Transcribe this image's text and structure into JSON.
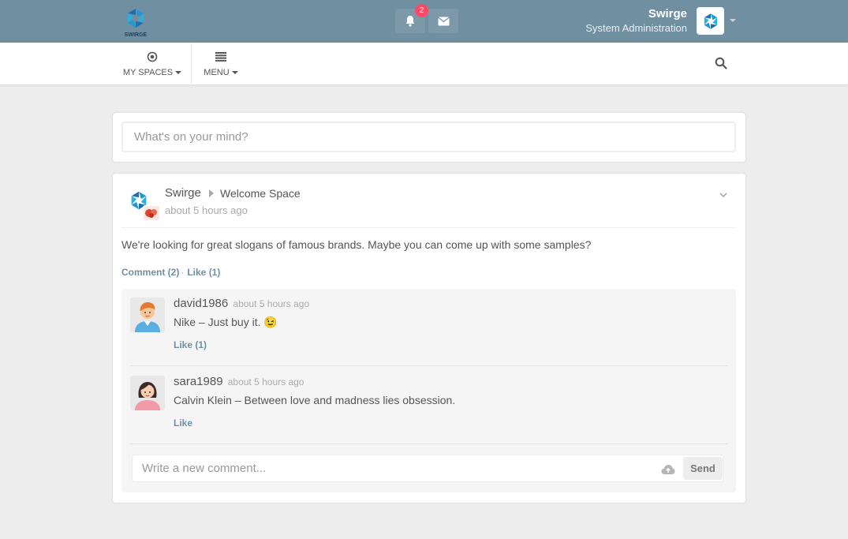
{
  "header": {
    "logo_text": "SWIRGE",
    "notifications": {
      "count": "2",
      "icon": "bell-icon"
    },
    "messages": {
      "icon": "envelope-icon"
    },
    "user": {
      "name": "Swirge",
      "role": "System Administration"
    }
  },
  "nav": {
    "my_spaces_label": "MY SPACES",
    "menu_label": "MENU",
    "search_icon": "search-icon"
  },
  "share": {
    "placeholder": "What's on your mind?"
  },
  "post": {
    "author": "Swirge",
    "space": "Welcome Space",
    "time": "about 5 hours ago",
    "text": "We're looking for great slogans of famous brands. Maybe you can come up with some samples?",
    "comment_label": "Comment (2)",
    "separator": "·",
    "like_label": "Like (1)"
  },
  "comments": [
    {
      "user": "david1986",
      "time": "about 5 hours ago",
      "text": "Nike – Just buy it.",
      "emoji": "😉",
      "like_label": "Like (1)"
    },
    {
      "user": "sara1989",
      "time": "about 5 hours ago",
      "text": "Calvin Klein – Between love and madness lies obsession.",
      "like_label": "Like"
    }
  ],
  "new_comment": {
    "placeholder": "Write a new comment...",
    "send_label": "Send"
  },
  "colors": {
    "topbar": "#708fa0",
    "accent": "#708fa0",
    "badge": "#fc4a64",
    "background": "#ededed"
  }
}
